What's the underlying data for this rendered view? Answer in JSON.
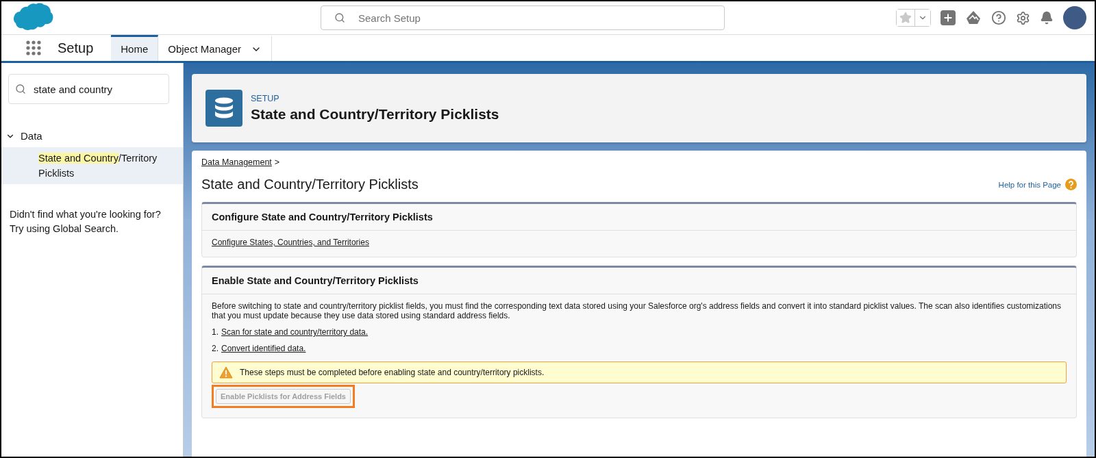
{
  "header": {
    "search": {
      "placeholder": "Search Setup"
    }
  },
  "nav": {
    "app_name": "Setup",
    "tabs": [
      {
        "label": "Home",
        "selected": true,
        "has_menu": false
      },
      {
        "label": "Object Manager",
        "selected": false,
        "has_menu": true
      }
    ]
  },
  "sidebar": {
    "search": {
      "value": "state and country"
    },
    "tree": [
      {
        "label": "Data",
        "expanded": true,
        "children": [
          {
            "match": "State and Country",
            "rest": "/Territory Picklists",
            "selected": true
          }
        ]
      }
    ],
    "hint": "Didn't find what you're looking for? Try using Global Search."
  },
  "page_header": {
    "eyebrow": "SETUP",
    "title": "State and Country/Territory Picklists"
  },
  "content": {
    "breadcrumb": {
      "link": "Data Management",
      "separator": ">"
    },
    "title": "State and Country/Territory Picklists",
    "help_link": "Help for this Page",
    "sections": [
      {
        "kind": "links",
        "title": "Configure State and Country/Territory Picklists",
        "links": [
          "Configure States, Countries, and Territories"
        ]
      },
      {
        "kind": "steps",
        "title": "Enable State and Country/Territory Picklists",
        "description": "Before switching to state and country/territory picklist fields, you must find the corresponding text data stored using your Salesforce org's address fields and convert it into standard picklist values. The scan also identifies customizations that you must update because they use data stored using standard address fields.",
        "steps": [
          {
            "number": "1.",
            "link": "Scan for state and country/territory data."
          },
          {
            "number": "2.",
            "link": "Convert identified data."
          }
        ],
        "warning": "These steps must be completed before enabling state and country/territory picklists.",
        "button": {
          "label": "Enable Picklists for Address Fields",
          "disabled": true,
          "highlighted": true
        }
      }
    ]
  }
}
